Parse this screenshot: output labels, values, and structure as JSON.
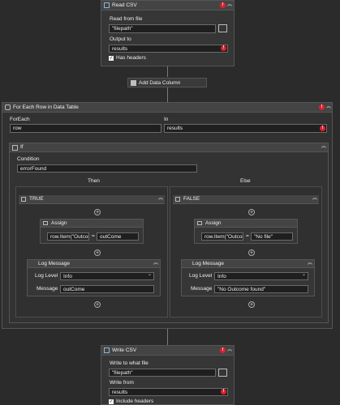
{
  "read_csv": {
    "title": "Read CSV",
    "read_label": "Read from file",
    "file_value": "\"filepath\"",
    "output_label": "Output to",
    "output_value": "results",
    "headers_label": "Has headers",
    "error_mark": "!",
    "collapse": "︽",
    "folder": "▭"
  },
  "add_column": {
    "label": "Add Data Column"
  },
  "foreach": {
    "title": "For Each Row in Data Table",
    "foreach_label": "ForEach",
    "foreach_value": "row",
    "in_label": "In",
    "in_value": "results"
  },
  "if_block": {
    "title": "If",
    "condition_label": "Condition",
    "condition_value": "errorFound",
    "then_label": "Then",
    "else_label": "Else"
  },
  "true_branch": {
    "title": "TRUE",
    "assign_title": "Assign",
    "assign_left": "row.Item(\"Outcom",
    "assign_eq": "=",
    "assign_right": "outCome",
    "log_title": "Log Message",
    "log_level_label": "Log Level",
    "log_level_value": "Info",
    "message_label": "Message",
    "message_value": "outCome"
  },
  "false_branch": {
    "title": "FALSE",
    "assign_title": "Assign",
    "assign_left": "row.Item(\"Outcom",
    "assign_eq": "=",
    "assign_right": "\"No file\"",
    "log_title": "Log Message",
    "log_level_label": "Log Level",
    "log_level_value": "Info",
    "message_label": "Message",
    "message_value": "\"No Outcome found\""
  },
  "write_csv": {
    "title": "Write CSV",
    "write_label": "Write to what file",
    "file_value": "\"filepath\"",
    "from_label": "Write from",
    "from_value": "results",
    "headers_label": "Include headers"
  },
  "plus": "+",
  "dropdown": "⌄",
  "check": "✓"
}
